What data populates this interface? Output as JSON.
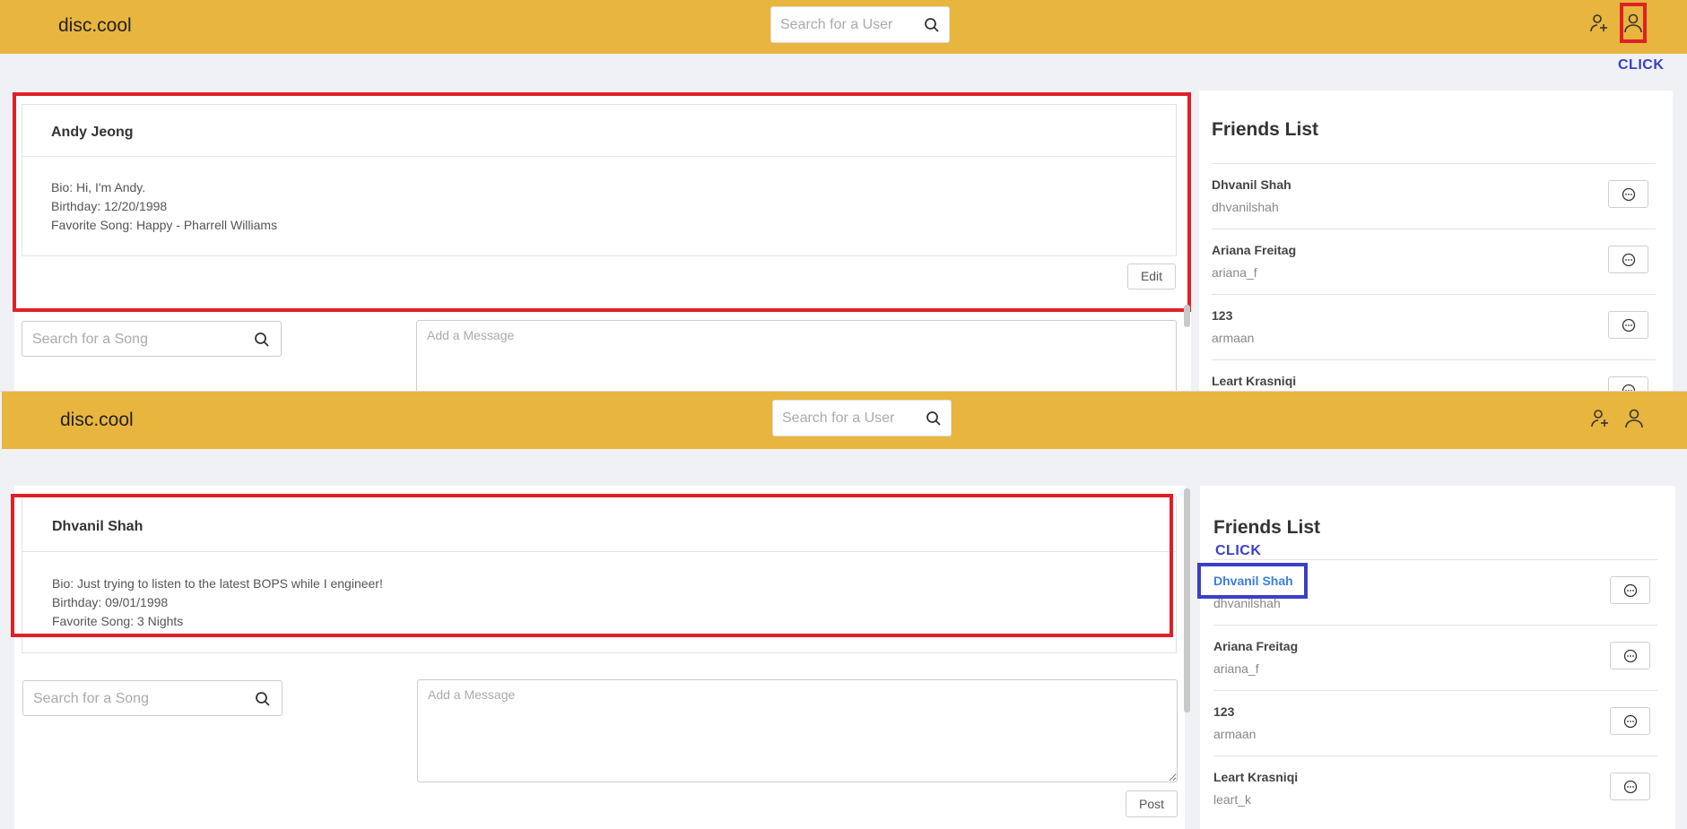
{
  "app": {
    "brand": "disc.cool"
  },
  "search_user": {
    "placeholder": "Search for a User"
  },
  "search_song": {
    "placeholder": "Search for a Song"
  },
  "message": {
    "placeholder": "Add a Message"
  },
  "annotations": {
    "click_label": "CLICK"
  },
  "colors": {
    "navbar": "#e8b53e",
    "highlight_red": "#e02026",
    "highlight_blue": "#3a3fc8",
    "link": "#3b7fd9"
  },
  "icons": {
    "add_friend": "user-plus-icon",
    "profile": "user-icon",
    "search": "search-icon",
    "chat": "chat-bubble-icon"
  },
  "screen1": {
    "profile": {
      "name": "Andy Jeong",
      "bio": "Bio: Hi, I'm Andy.",
      "birthday": "Birthday: 12/20/1998",
      "favorite_song": "Favorite Song: Happy - Pharrell Williams",
      "edit_label": "Edit"
    },
    "friends_title": "Friends List",
    "friends": [
      {
        "name": "Dhvanil Shah",
        "username": "dhvanilshah"
      },
      {
        "name": "Ariana Freitag",
        "username": "ariana_f"
      },
      {
        "name": "123",
        "username": "armaan"
      },
      {
        "name": "Leart Krasniqi",
        "username": ""
      }
    ]
  },
  "screen2": {
    "profile": {
      "name": "Dhvanil Shah",
      "bio": "Bio: Just trying to listen to the latest BOPS while I engineer!",
      "birthday": "Birthday: 09/01/1998",
      "favorite_song": "Favorite Song: 3 Nights"
    },
    "post_label": "Post",
    "friends_title": "Friends List",
    "friends": [
      {
        "name": "Dhvanil Shah",
        "username": "dhvanilshah"
      },
      {
        "name": "Ariana Freitag",
        "username": "ariana_f"
      },
      {
        "name": "123",
        "username": "armaan"
      },
      {
        "name": "Leart Krasniqi",
        "username": "leart_k"
      }
    ]
  }
}
